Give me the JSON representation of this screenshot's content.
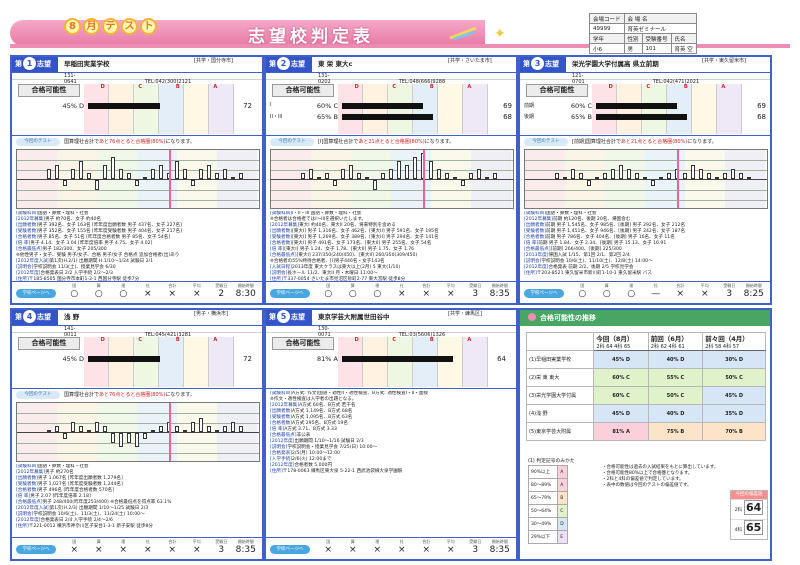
{
  "header": {
    "month": "8",
    "month_unit": "月",
    "test_label": [
      "テ",
      "ス",
      "ト"
    ],
    "title": "志望校判定表",
    "student": {
      "labels": [
        "会場コード",
        "会 場 名",
        "学年",
        "性別",
        "受験番号",
        "氏名"
      ],
      "venue_code": "49999",
      "venue_name": "育英ゼミナール",
      "grade": "小6",
      "gender": "男",
      "exam_number": "101",
      "name": "育英 空"
    }
  },
  "panels": [
    {
      "rank": "1",
      "rank_label": "志望",
      "school": "早稲田実業学校",
      "location": "[共学・国分寺市]",
      "code": "131-0641",
      "tel": "TEL:042(300)2121",
      "capacity_label": "合格可能性",
      "letters": [
        "D",
        "C",
        "B",
        "A"
      ],
      "rows": [
        {
          "prefix": "",
          "pct": "45%",
          "grade": "D",
          "value": 0.55
        }
      ],
      "score": "72",
      "notice_pill": "今回のテスト",
      "notice": "国算理社合計で",
      "notice_red": "あと76点とると合格圏(80%)",
      "notice_end": "になります。",
      "graph": [
        2,
        3,
        -1,
        2,
        4,
        1,
        -2,
        3,
        5,
        2,
        1,
        -1,
        0,
        2,
        3,
        1,
        4,
        2,
        -1,
        2,
        3,
        1,
        2,
        0,
        1
      ],
      "detail": [
        [
          "[試験科目]",
          "国語・算数・理科・社会"
        ],
        [
          "[2012年募集]",
          "男子 約70名、女子 約40名"
        ],
        [
          "[出願者数]",
          "男子 392名、女子 163名  [昨年度出願者数 男子 437名、女子 227名]"
        ],
        [
          "[受験者数]",
          "男子 352名、女子 155名  [昨年度受験者数 男子 404名、女子 217名]"
        ],
        [
          "[合格者数]",
          "男子 85名、女子 51名  [昨年度合格者数 男子 85名、女子 54名]"
        ],
        [
          "[倍  率]",
          "男子 4.14、女子 3.04   [昨年度倍率 男子 4.75、女子 4.02]"
        ],
        [
          "[合格最低点]",
          "男子 182/300、女子 205/300"
        ],
        [
          "",
          "※他性男子・女子、受験 男子/女子、合格 男子/女子 合格点 追加合格者(出)あり"
        ],
        [
          "[2012年度入試]",
          "第1次(H.2/1)  出願期間 H.1/10〜1/24  試験日 2/1"
        ],
        [
          "[説明会]",
          "学校説明会 11/3(土)、授業見学会 6/30"
        ],
        [
          "[2012年度]",
          "合格発表日 2/2  入学手続 2/2〜2/3"
        ],
        [
          "[住所]",
          "〒185-8505 国分寺市本町1-2-1  西国分寺駅 徒歩7分"
        ]
      ],
      "footer": {
        "link": "学校ページへ",
        "labels": [
          "国",
          "算",
          "理",
          "社",
          "合計",
          "平均",
          "受験日",
          "開始時間"
        ],
        "values": [
          "○",
          "○",
          "○",
          "×",
          "×",
          "×",
          "2",
          "8:30"
        ]
      }
    },
    {
      "rank": "2",
      "rank_label": "志望",
      "school": "東 栄 東大c",
      "location": "[共学・さいたま市]",
      "code": "131-0202",
      "tel": "TEL:048(666)9288",
      "capacity_label": "合格可能性",
      "letters": [
        "D",
        "C",
        "B",
        "A"
      ],
      "rows": [
        {
          "prefix": "I",
          "pct": "60%",
          "grade": "C",
          "value": 0.62
        },
        {
          "prefix": "II・III",
          "pct": "65%",
          "grade": "B",
          "value": 0.7
        }
      ],
      "scores": [
        "69",
        "68"
      ],
      "notice_pill": "今回のテスト",
      "notice": "[I]国算理社合計で",
      "notice_red": "あと21点とると合格圏(80%)",
      "notice_end": "になります。",
      "graph": [
        1,
        2,
        0,
        1,
        -1,
        2,
        3,
        1,
        0,
        -2,
        1,
        2,
        4,
        3,
        5,
        6,
        4,
        2,
        1,
        0,
        -1,
        1,
        2,
        0,
        1
      ],
      "detail": [
        [
          "[試験科目]",
          "I・II・III  国語・算数・理科・社会"
        ],
        [
          "",
          "※合格者は合格者ではI〜IIIを選択いたします。"
        ],
        [
          "[2012年募集]",
          "東大I 約40名、東大II 20名、将来特別を含める"
        ],
        [
          "[出願者数]",
          "[東大I] 男子 1,316名、女子 462名、[東大II] 男子 591名、女子 195名"
        ],
        [
          "[受験者数]",
          "[東大I] 男子 1,269名、女子 389名、[東大II] 男子 294名、女子 141名"
        ],
        [
          "[合格者数]",
          "[東大I] 男子 491名、女子 173名、[東大II] 男子 255名、女子 54名"
        ],
        [
          "[倍  率]",
          "[東大I] 男子 1.24、女子 1.78、[東大II] 男子 1.75、女子 1.76"
        ],
        [
          "[合格最低点]",
          "[東大I] 237/350(240/450)、[東大II] 260/350(309/450)"
        ],
        [
          "",
          "※合格者の55%特待合格者、[I]男子446名・女子143名"
        ],
        [
          "[入試日程]",
          "2013年度 東大クラスは東大以上(2月) 5 東大(1/10)"
        ],
        [
          "[説明会]",
          "長ホール 11/2、東大II 月・木曜日 11:00〜"
        ],
        [
          "[住所]",
          "〒337-0054 さいたま市見沼区砂町2-77  東大宮駅 徒歩8分"
        ]
      ],
      "footer": {
        "link": "学校ページへ",
        "labels": [
          "国",
          "算",
          "理",
          "社",
          "合計",
          "平均",
          "受験日",
          "開始時間"
        ],
        "values": [
          "○",
          "○",
          "○",
          "×",
          "×",
          "×",
          "3",
          "8:35"
        ]
      }
    },
    {
      "rank": "3",
      "rank_label": "志望",
      "school": "栄光学園大学付属高 県立前期",
      "location": "[共学・東久留米市]",
      "code": "121-0701",
      "tel": "TEL:042(471)2021",
      "capacity_label": "合格可能性",
      "letters": [
        "D",
        "C",
        "B",
        "A"
      ],
      "rows": [
        {
          "prefix": "前期",
          "pct": "60%",
          "grade": "C",
          "value": 0.62
        },
        {
          "prefix": "後期",
          "pct": "65%",
          "grade": "B",
          "value": 0.7
        }
      ],
      "scores": [
        "69",
        "68"
      ],
      "notice_pill": "今回のテスト",
      "notice": "[前期]国算理社合計で",
      "notice_red": "あと21点とると合格圏(80%)",
      "notice_end": "になります。",
      "graph": [
        1,
        0,
        2,
        1,
        -1,
        0,
        1,
        2,
        3,
        2,
        1,
        0,
        -1,
        0,
        1,
        2,
        1,
        3,
        2,
        1,
        0,
        1,
        2,
        1,
        0
      ],
      "detail": [
        [
          "[試験科目]",
          "国語・算数・理科・社会"
        ],
        [
          "[2012年募集]",
          "前期 約120名、後期 20名、帰国含む"
        ],
        [
          "[出願者数]",
          "前期 男子 1,545名、女子 985名、[後期] 男子 292名、女子 212名"
        ],
        [
          "[受験者数]",
          "前期 男子 1,451名、女子 946名、[後期] 男子 242名、女子 187名"
        ],
        [
          "[合格者数]",
          "前期 男子 786名、女子 404名、[後期] 男子 16名、女子 11名"
        ],
        [
          "[倍  率]",
          "前期 男子 1.84、女子 2.34、[後期] 男子 15.13、女子 16.91"
        ],
        [
          "[合格最低点]",
          "[前期] 266/400、[後期] 225/300"
        ],
        [
          "[2013年度]",
          "帰国入試 1/15、第1回 2/1、第2回 2/4"
        ],
        [
          "[説明会]",
          "学校説明会 10/6(土)、11/10(土)、12/8(土) 14:00〜"
        ],
        [
          "[2012年度]",
          "合格発表 前期 2/2、後期 2/5  学校見学会"
        ],
        [
          "[住所]",
          "〒203-8521 東久留米市新川町1-10-1  東久留米駅 バス"
        ]
      ],
      "footer": {
        "link": "学校ページへ",
        "labels": [
          "国",
          "算",
          "理",
          "社",
          "合計",
          "平均",
          "受験日",
          "開始時間"
        ],
        "values": [
          "○",
          "○",
          "○",
          "—",
          "×",
          "×",
          "3",
          "8:25"
        ]
      }
    },
    {
      "rank": "4",
      "rank_label": "志望",
      "school": "浅 野",
      "location": "[男子・横浜市]",
      "code": "141-0011",
      "tel": "TEL:045(421)3281",
      "capacity_label": "合格可能性",
      "letters": [
        "D",
        "C",
        "B",
        "A"
      ],
      "rows": [
        {
          "prefix": "",
          "pct": "45%",
          "grade": "D",
          "value": 0.55
        }
      ],
      "score": "72",
      "notice_pill": "今回のテスト",
      "notice": "国算理社合計で",
      "notice_red": "あと76点とると合格圏(80%)",
      "notice_end": "になります。",
      "graph": [
        0,
        1,
        -1,
        2,
        1,
        0,
        2,
        1,
        -2,
        -3,
        -2,
        -3,
        -1,
        0,
        1,
        2,
        1,
        0,
        2,
        3,
        1,
        0,
        1,
        2,
        1
      ],
      "detail": [
        [
          "[試験科目]",
          "国語・算数・理科・社会"
        ],
        [
          "[2012年募集]",
          "男子 約270名"
        ],
        [
          "[出願者数]",
          "男子 1,067名  [昨年度出願者数 1,279名]"
        ],
        [
          "[受験者数]",
          "男子 1,027名  [昨年度受験者数 1,244名]"
        ],
        [
          "[合格者数]",
          "男子 496名  [昨年度合格者数 570名]"
        ],
        [
          "[倍  率]",
          "男子 2.07  [昨年度倍率 2.18]"
        ],
        [
          "[合格最低点]",
          "男子 248/400(昨年度253/400)  ※合格最低点を得点率 63.1%"
        ],
        [
          "[2012年度入試]",
          "第1次(H.2/3) 出願期間 1/10〜1/25  試験日 2/3"
        ],
        [
          "[説明会]",
          "学校説明会 10/6(土)、11/3(土)、11/24(土) 10:00〜"
        ],
        [
          "[2012年度]",
          "合格発表日 2/4  入学手続 2/4〜2/6"
        ],
        [
          "[住所]",
          "〒221-0012 横浜市神奈川区子安台1-3-1  新子安駅 徒歩8分"
        ]
      ],
      "footer": {
        "link": "学校ページへ",
        "labels": [
          "国",
          "算",
          "理",
          "社",
          "合計",
          "平均",
          "受験日",
          "開始時間"
        ],
        "values": [
          "×",
          "×",
          "×",
          "×",
          "×",
          "×",
          "3",
          "8:35"
        ]
      }
    },
    {
      "rank": "5",
      "rank_label": "志望",
      "school": "東京学芸大附属世田谷中",
      "location": "[共学・練馬区]",
      "code": "130-0071",
      "tel": "TEL:03(5606)1326",
      "capacity_label": "合格可能性",
      "letters": [
        "D",
        "C",
        "B",
        "A"
      ],
      "rows": [
        {
          "prefix": "",
          "pct": "81%",
          "grade": "A",
          "value": 0.85
        }
      ],
      "score": "64",
      "notice_pill": "",
      "notice": "",
      "notice_red": "",
      "notice_end": "",
      "graph": [],
      "detail": [
        [
          "[試験科目]",
          "A方式: 作文(国語・適性I)・適性検査、B方式: 適性検査I・II・面接"
        ],
        [
          "",
          "※作文・適性検査は入学者の出題となる。"
        ],
        [
          "[2012年募集]",
          "A方式 60名、B方式 若干名"
        ],
        [
          "[出願者数]",
          "A方式 1,149名、B方式 68名"
        ],
        [
          "[受験者数]",
          "A方式 1,095名、B方式 63名"
        ],
        [
          "[合格者数]",
          "A方式 295名、B方式 19名"
        ],
        [
          "[倍  率]",
          "A方式 3.71、B方式 3.33"
        ],
        [
          "[合格最低点]",
          "非公表"
        ],
        [
          "[2012年度]",
          "出願期間 1/10〜1/16  試験日 2/3"
        ],
        [
          "[説明会]",
          "学校説明会・授業見学会 7/25(日) 10:00〜"
        ],
        [
          "[合格発表]",
          "2/5(月) 10:00〜12:00"
        ],
        [
          "[入学手続]",
          "2/6(火) 12:00まで"
        ],
        [
          "[2012年度]",
          "合格者数 5,000円"
        ],
        [
          "[住所]",
          "〒178-0063 練馬区東大泉 5-22-1  西武池袋線大泉学園駅"
        ]
      ],
      "footer": {
        "link": "学校ページへ",
        "labels": [
          "国",
          "算",
          "理",
          "社",
          "合計",
          "平均",
          "受験日",
          "開始時間"
        ],
        "values": [
          "×",
          "×",
          "×",
          "×",
          "×",
          "×",
          "3",
          "8:35"
        ]
      }
    }
  ],
  "trend": {
    "title": "合格可能性の推移",
    "columns": [
      {
        "label": "今回（8月）",
        "scores": [
          "64",
          "65"
        ]
      },
      {
        "label": "前回（6月）",
        "scores": [
          "62",
          "61"
        ]
      },
      {
        "label": "前々回（4月）",
        "scores": [
          "58",
          "57"
        ]
      }
    ],
    "rows": [
      {
        "name": "(1)早稲田実業学校",
        "levels": [
          "45% D",
          "40% D",
          "30% D"
        ]
      },
      {
        "name": "(2)栄 東 東大",
        "levels": [
          "60% C",
          "55% C",
          "50% C"
        ]
      },
      {
        "name": "(3)栄光学園大学付属",
        "levels": [
          "60% C",
          "50% C",
          "45% D"
        ]
      },
      {
        "name": "(4)浅 野",
        "levels": [
          "45% D",
          "40% D",
          "35% D"
        ]
      },
      {
        "name": "(5)東京学芸大附属",
        "levels": [
          "81% A",
          "75% B",
          "70% B"
        ]
      }
    ],
    "legend": [
      {
        "range": "90%以上",
        "label": "A"
      },
      {
        "range": "80〜89%",
        "label": "A"
      },
      {
        "range": "65〜79%",
        "label": "B"
      },
      {
        "range": "50〜64%",
        "label": "C"
      },
      {
        "range": "30〜49%",
        "label": "D"
      },
      {
        "range": "29%以下",
        "label": "E"
      }
    ],
    "legend_title": "(1) 判定記号のみかた",
    "notes": [
      "・合格可能性は過去の入試結果をもとに算出しています。",
      "・合格可能性80%以上で合格圏となります。",
      "・2科と4科の偏差値で判定しています。",
      "・表中の数値は今回のテストの偏差値です。"
    ],
    "deviation": {
      "title": "今回の偏差値",
      "rows": [
        {
          "label": "2科",
          "value": "64"
        },
        {
          "label": "4科",
          "value": "65"
        }
      ]
    }
  }
}
